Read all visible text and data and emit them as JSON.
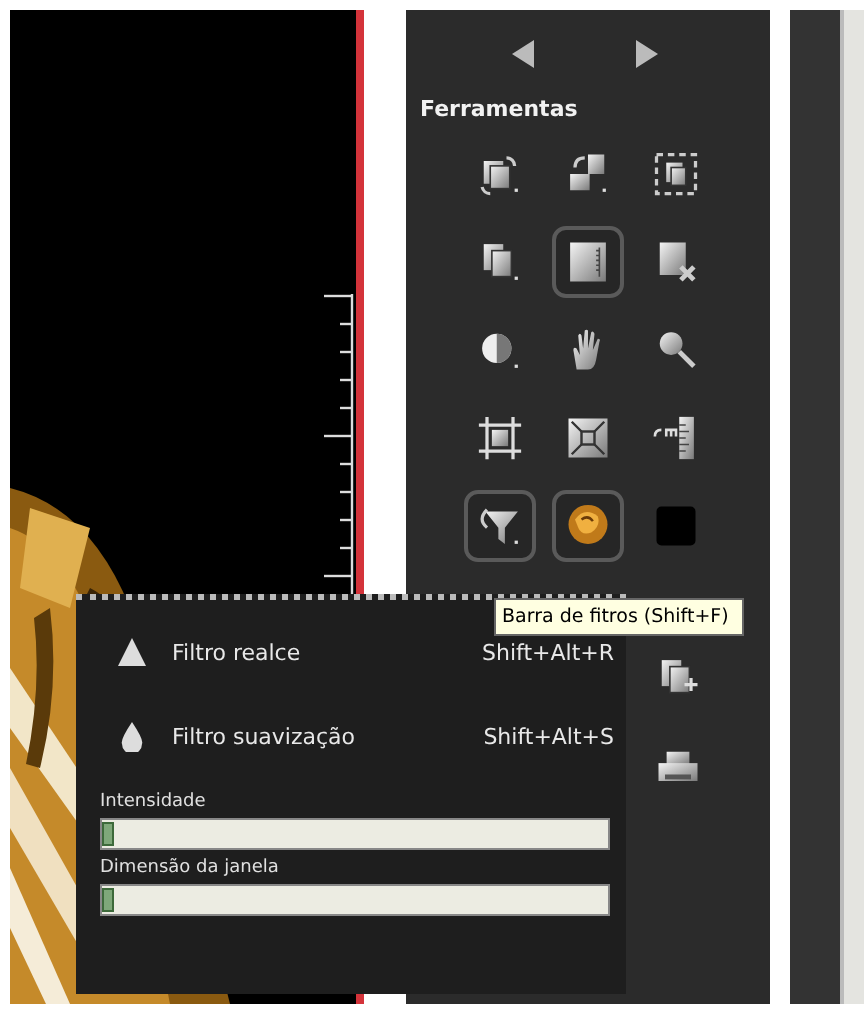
{
  "tools_panel": {
    "title": "Ferramentas",
    "tools": [
      {
        "selected": false
      },
      {
        "selected": false
      },
      {
        "selected": false
      },
      {
        "selected": false
      },
      {
        "selected": true
      },
      {
        "selected": false
      },
      {
        "selected": false
      },
      {
        "selected": false
      },
      {
        "selected": false
      },
      {
        "selected": false
      },
      {
        "selected": false
      },
      {
        "selected": false
      },
      {
        "selected": true
      },
      {
        "selected": true
      },
      {
        "selected": false
      }
    ],
    "extra_tools": [
      {
        "selected": false
      },
      {
        "selected": false
      }
    ]
  },
  "tooltip": {
    "text": "Barra de fitros (Shift+F)"
  },
  "filter_menu": {
    "items": [
      {
        "label": "Filtro realce",
        "shortcut": "Shift+Alt+R"
      },
      {
        "label": "Filtro suavização",
        "shortcut": "Shift+Alt+S"
      }
    ],
    "sliders": [
      {
        "label": "Intensidade",
        "level": 0
      },
      {
        "label": "Dimensão da janela",
        "level": 0
      }
    ]
  }
}
